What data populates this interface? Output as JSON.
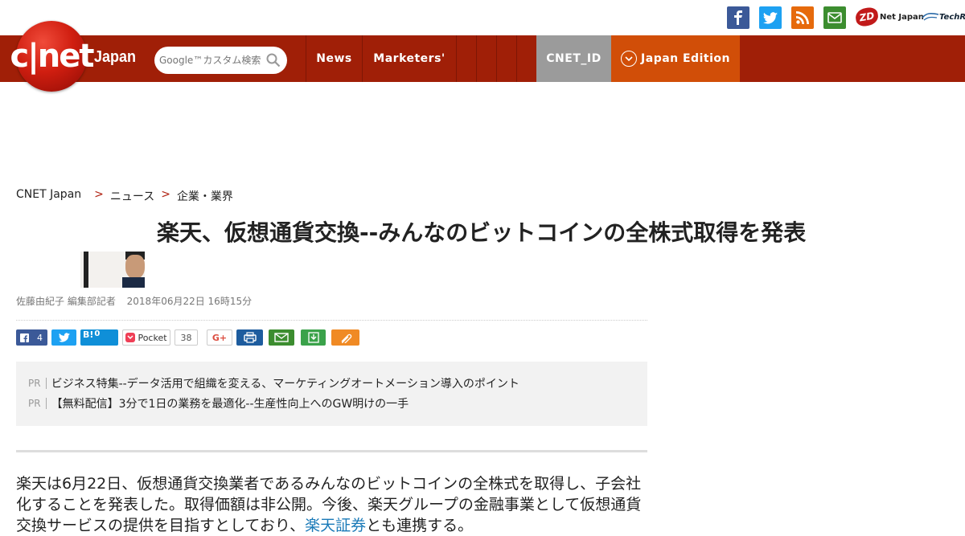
{
  "top_strip": {
    "icons": [
      "facebook-icon",
      "twitter-icon",
      "rss-icon",
      "mail-icon"
    ],
    "zdnet": {
      "badge": "ZD",
      "text": "Net Japan"
    },
    "techrepublic": "TechRep"
  },
  "nav": {
    "logo_text": "c|net",
    "logo_japan": "Japan",
    "search_placeholder": "Google™カスタム検索",
    "items": [
      "News",
      "Marketers'"
    ],
    "cnet_id": "CNET_ID",
    "edition": "Japan Edition"
  },
  "breadcrumb": {
    "root": "CNET Japan",
    "sep": ">",
    "level1": "ニュース",
    "level2": "企業・業界"
  },
  "article": {
    "headline": "楽天、仮想通貨交換--みんなのビットコインの全株式取得を発表",
    "author": "佐藤由紀子 編集部記者",
    "date": "2018年06月22日 16時15分"
  },
  "share": {
    "facebook_count": "4",
    "hatena_label": "B!",
    "hatena_count": "0",
    "pocket_label": "Pocket",
    "pocket_count": "38",
    "gplus_label": "G+"
  },
  "pr": {
    "tag": "PR",
    "items": [
      "ビジネス特集--データ活用で組織を変える、マーケティングオートメーション導入のポイント",
      "【無料配信】3分で1日の業務を最適化--生産性向上へのGW明けの一手"
    ]
  },
  "body": {
    "lead": "楽天は6月22日、仮想通貨交換業者であるみんなのビットコインの全株式を取得し、子会社化することを発表した。取得価額は非公開。今後、楽天グループの金融事業として仮想通貨交換サービスの提供を目指すとしており、",
    "link": "楽天証券",
    "tail": "とも連携する。"
  },
  "colors": {
    "nav_bg": "#a01f07",
    "accent_red": "#b02010",
    "cnet_id_bg": "#9b9b9b",
    "edition_bg": "#d14e08",
    "link": "#1a7ab8"
  }
}
